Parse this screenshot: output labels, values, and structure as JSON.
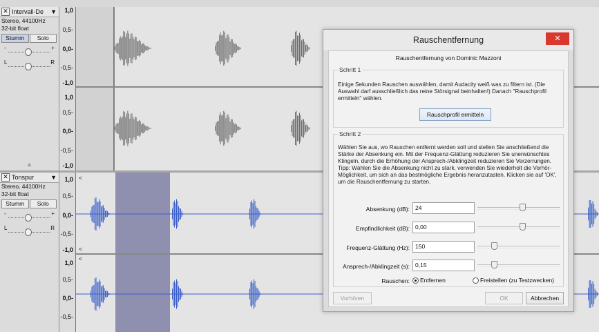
{
  "track1": {
    "name": "Intervall-De",
    "info_line1": "Stereo, 44100Hz",
    "info_line2": "32-bit float",
    "mute_label": "Stumm",
    "solo_label": "Solo",
    "gain_minus": "-",
    "gain_plus": "+",
    "pan_left": "L",
    "pan_right": "R",
    "ruler_top": [
      "1,0",
      "0,5-",
      "0,0-",
      "-0,5-",
      "-1,0"
    ],
    "ruler_bottom": [
      "1,0",
      "0,5-",
      "0,0-",
      "-0,5-",
      "-1,0"
    ],
    "collapse_icon": "▲"
  },
  "track2": {
    "name": "Tonspur",
    "info_line1": "Stereo, 44100Hz",
    "info_line2": "32-bit float",
    "mute_label": "Stumm",
    "solo_label": "Solo",
    "gain_minus": "-",
    "gain_plus": "+",
    "pan_left": "L",
    "pan_right": "R",
    "ruler_top": [
      "1,0",
      "0,5-",
      "0,0-",
      "-0,5-",
      "-1,0"
    ],
    "ruler_bottom": [
      "1,0",
      "0,5-",
      "0,0-",
      "-0,5-"
    ]
  },
  "track_close_glyph": "✕",
  "track_dropdown_glyph": "▼",
  "dialog": {
    "title": "Rauschentfernung",
    "close_glyph": "✕",
    "subtitle": "Rauschentfernung von Dominic Mazzoni",
    "step1": {
      "legend": "Schritt 1",
      "text": "Einige Sekunden Rauschen auswählen, damit Audacity weiß was zu filtern ist. (Die Auswahl darf ausschließlich das reine Störsignal beinhalten!) Danach \"Rauschprofil ermitteln\" wählen.",
      "button": "Rauschprofil ermitteln"
    },
    "step2": {
      "legend": "Schritt 2",
      "text": "Wählen Sie aus, wo Rauschen entfernt werden soll und stellen Sie anschließend die Stärke der Absenkung ein. Mit der Frequenz-Glättung reduzieren Sie unerwünschtes Klingeln, durch die Erhöhung der Ansprech-/Abklingzeit reduzieren Sie Verzerrungen. Tipp: Wählen Sie die Absenkung nicht zu stark, verwenden Sie wiederholt die Vorhör-Möglichkeit, um sich an das bestmögliche Ergebnis heranzutasten. Klicken sie auf 'OK', um die Rauschentfernung zu starten.",
      "params": [
        {
          "label": "Absenkung (dB):",
          "value": "24",
          "slider": 0.55
        },
        {
          "label": "Empfindlichkeit (dB):",
          "value": "0,00",
          "slider": 0.55
        },
        {
          "label": "Frequenz-Glättung (Hz):",
          "value": "150",
          "slider": 0.18
        },
        {
          "label": "Ansprech-/Abklingzeit (s):",
          "value": "0,15",
          "slider": 0.18
        }
      ],
      "noise_label": "Rauschen:",
      "radio_remove": "Entfernen",
      "radio_isolate": "Freistellen (zu Testzwecken)"
    },
    "preview_button": "Vorhören",
    "ok_button": "OK",
    "cancel_button": "Abbrechen"
  },
  "colors": {
    "wave_grey": "#6e6e6e",
    "wave_blue": "#3a5fc8",
    "selection": "#8f8fb0"
  }
}
